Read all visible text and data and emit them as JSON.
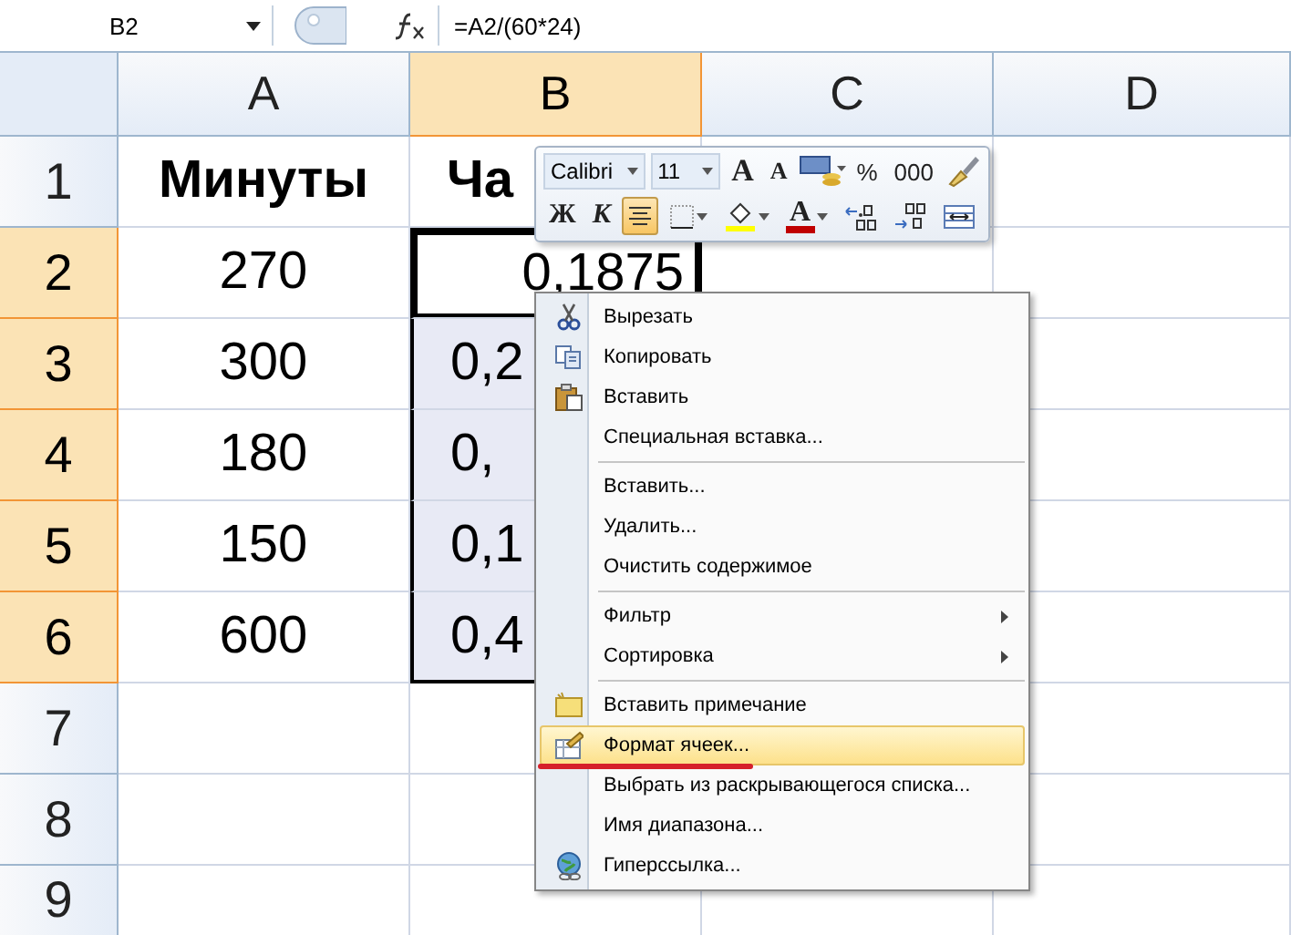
{
  "formula_bar": {
    "name_box": "B2",
    "formula": "=A2/(60*24)"
  },
  "columns": [
    {
      "label": "A",
      "selected": false
    },
    {
      "label": "B",
      "selected": true
    },
    {
      "label": "C",
      "selected": false
    },
    {
      "label": "D",
      "selected": false
    }
  ],
  "rows": [
    {
      "header": "1",
      "kind": "heading",
      "selected": false,
      "cells": [
        {
          "text": "Минуты",
          "selected": false,
          "active": false
        },
        {
          "text": "Ча",
          "selected": false,
          "active": false
        }
      ]
    },
    {
      "header": "2",
      "kind": "data",
      "selected": true,
      "cells": [
        {
          "text": "270",
          "selected": false,
          "active": false
        },
        {
          "text": "0,1875",
          "selected": true,
          "active": true
        }
      ]
    },
    {
      "header": "3",
      "kind": "data",
      "selected": true,
      "cells": [
        {
          "text": "300",
          "selected": false,
          "active": false
        },
        {
          "text": "0,2",
          "selected": true,
          "active": false
        }
      ]
    },
    {
      "header": "4",
      "kind": "data",
      "selected": true,
      "cells": [
        {
          "text": "180",
          "selected": false,
          "active": false
        },
        {
          "text": "0,",
          "selected": true,
          "active": false
        }
      ]
    },
    {
      "header": "5",
      "kind": "data",
      "selected": true,
      "cells": [
        {
          "text": "150",
          "selected": false,
          "active": false
        },
        {
          "text": "0,1",
          "selected": true,
          "active": false
        }
      ]
    },
    {
      "header": "6",
      "kind": "data",
      "selected": true,
      "cells": [
        {
          "text": "600",
          "selected": false,
          "active": false
        },
        {
          "text": "0,4",
          "selected": true,
          "active": false
        }
      ]
    },
    {
      "header": "7",
      "selected": false,
      "cells": []
    },
    {
      "header": "8",
      "selected": false,
      "cells": []
    },
    {
      "header": "9",
      "selected": false,
      "cells": []
    }
  ],
  "mini_toolbar": {
    "font": "Calibri",
    "size": "11",
    "row_1": [
      {
        "kind": "grow",
        "text": "A"
      },
      {
        "kind": "shrink",
        "text": "A"
      },
      {
        "kind": "currency"
      },
      {
        "kind": "text",
        "text": "%"
      },
      {
        "kind": "text",
        "text": "000"
      },
      {
        "kind": "brush"
      }
    ],
    "row_2": [
      {
        "kind": "text",
        "text": "Ж",
        "on": false
      },
      {
        "kind": "italic",
        "text": "К",
        "on": false
      },
      {
        "kind": "align",
        "on": true
      },
      {
        "kind": "borders",
        "on": false
      },
      {
        "kind": "fill",
        "on": false
      },
      {
        "kind": "fontcolor",
        "text": "A",
        "on": false
      },
      {
        "kind": "incdec",
        "on": false
      },
      {
        "kind": "decdec",
        "on": false
      },
      {
        "kind": "merge",
        "on": false
      }
    ]
  },
  "context_menu": {
    "groups": [
      [
        {
          "label": "Вырезать",
          "kind": "cut",
          "submenu": false,
          "selected": false,
          "marked": false
        },
        {
          "label": "Копировать",
          "kind": "copy",
          "submenu": false,
          "selected": false,
          "marked": false
        },
        {
          "label": "Вставить",
          "kind": "paste",
          "submenu": false,
          "selected": false,
          "marked": false
        },
        {
          "label": "Специальная вставка...",
          "kind": "plain",
          "submenu": false,
          "selected": false,
          "marked": false
        }
      ],
      [
        {
          "label": "Вставить...",
          "kind": "plain",
          "submenu": false,
          "selected": false,
          "marked": false
        },
        {
          "label": "Удалить...",
          "kind": "plain",
          "submenu": false,
          "selected": false,
          "marked": false
        },
        {
          "label": "Очистить содержимое",
          "kind": "plain",
          "submenu": false,
          "selected": false,
          "marked": false
        }
      ],
      [
        {
          "label": "Фильтр",
          "kind": "plain",
          "submenu": true,
          "selected": false,
          "marked": false
        },
        {
          "label": "Сортировка",
          "kind": "plain",
          "submenu": true,
          "selected": false,
          "marked": false
        }
      ],
      [
        {
          "label": "Вставить примечание",
          "kind": "note",
          "submenu": false,
          "selected": false,
          "marked": false
        },
        {
          "label": "Формат ячеек...",
          "kind": "format",
          "submenu": false,
          "selected": true,
          "marked": true
        },
        {
          "label": "Выбрать из раскрывающегося списка...",
          "kind": "plain",
          "submenu": false,
          "selected": false,
          "marked": false
        },
        {
          "label": "Имя диапазона...",
          "kind": "plain",
          "submenu": false,
          "selected": false,
          "marked": false
        },
        {
          "label": "Гиперссылка...",
          "kind": "link",
          "submenu": false,
          "selected": false,
          "marked": false
        }
      ]
    ]
  }
}
